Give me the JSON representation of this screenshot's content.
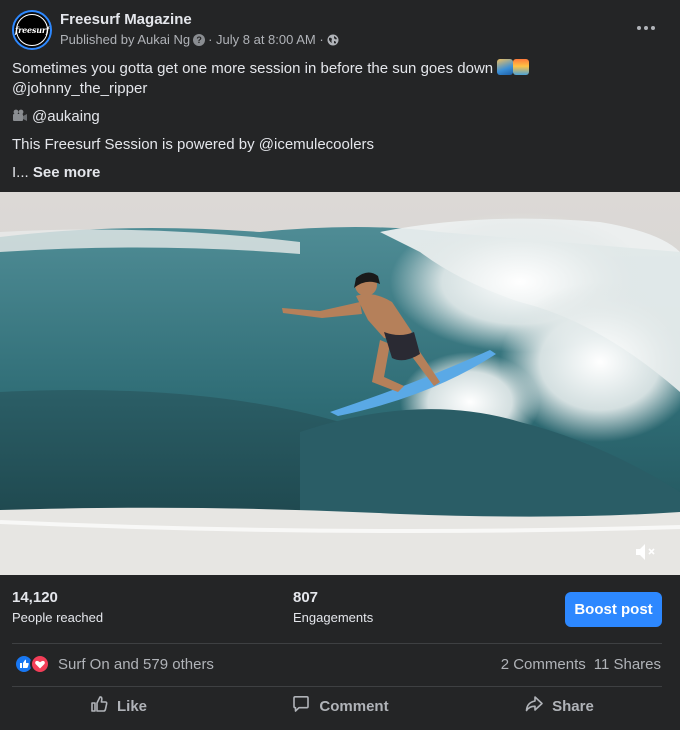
{
  "post": {
    "page_name": "Freesurf Magazine",
    "avatar_text": "freesurf",
    "published_by": "Published by Aukai Ng",
    "date": "· July 8 at 8:00 AM ·"
  },
  "caption": {
    "line1": "Sometimes you gotta get one more session in before the sun goes down",
    "line2": "@johnny_the_ripper",
    "line3": "@aukaing",
    "line4": "This Freesurf Session is powered by @icemulecoolers",
    "line5_prefix": "I...",
    "see_more": "See more"
  },
  "stats": {
    "reached_value": "14,120",
    "reached_label": "People reached",
    "engagements_value": "807",
    "engagements_label": "Engagements",
    "boost_label": "Boost post"
  },
  "reactions": {
    "text": "Surf On and 579 others",
    "comments": "2 Comments",
    "shares": "11 Shares"
  },
  "actions": {
    "like": "Like",
    "comment": "Comment",
    "share": "Share"
  },
  "colors": {
    "background": "#242526",
    "boost_button": "#2d88ff",
    "like_reaction": "#1877f2",
    "love_reaction": "#f33e58"
  },
  "icons": [
    "help-icon",
    "globe-icon",
    "more-options-icon",
    "surfer-emoji-icon",
    "sunset-emoji-icon",
    "camera-emoji-icon",
    "mute-icon",
    "like-reaction-icon",
    "love-reaction-icon",
    "thumbs-up-icon",
    "comment-icon",
    "share-icon"
  ]
}
